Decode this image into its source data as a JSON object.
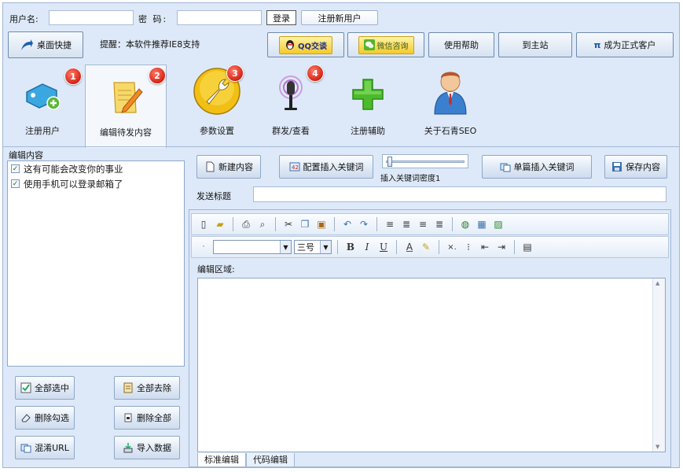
{
  "login": {
    "username_label": "用户名:",
    "password_label": "密  码:",
    "login_button": "登录",
    "register_button": "注册新用户",
    "username_value": "",
    "password_value": ""
  },
  "toolbar": {
    "desktop_shortcut": "桌面快捷",
    "notice": "提醒：本软件推荐IE8支持",
    "qq_button": "QQ交谈",
    "wechat_button": "微信咨询",
    "help_button": "使用帮助",
    "home_button": "到主站",
    "upgrade_button": "成为正式客户",
    "upgrade_prefix": "π"
  },
  "tabs": [
    {
      "label": "注册用户",
      "badge": "1",
      "icon": "tag-add-icon"
    },
    {
      "label": "编辑待发内容",
      "badge": "2",
      "icon": "edit-note-icon"
    },
    {
      "label": "参数设置",
      "badge": "3",
      "icon": "wrench-icon"
    },
    {
      "label": "群发/查看",
      "badge": "4",
      "icon": "microphone-icon"
    },
    {
      "label": "注册辅助",
      "icon": "plus-icon"
    },
    {
      "label": "关于石青SEO",
      "icon": "user-icon"
    }
  ],
  "left": {
    "group_title": "编辑内容",
    "items": [
      "这有可能会改变你的事业",
      "使用手机可以登录邮箱了"
    ],
    "select_all": "全部选中",
    "deselect_all": "全部去除",
    "delete_checked": "删除勾选",
    "delete_all": "删除全部",
    "mix_url": "混淆URL",
    "import_data": "导入数据"
  },
  "content": {
    "new_button": "新建内容",
    "config_keywords_button": "配置插入关键词",
    "keyword_density_label": "插入关键词密度1",
    "keyword_density_value": 0.02,
    "single_insert_button": "单篇插入关键词",
    "save_button": "保存内容",
    "title_label": "发送标题",
    "title_value": "",
    "edit_area_label": "编辑区域:",
    "font_size": "三号",
    "font_name": "",
    "tab_standard": "标准编辑",
    "tab_code": "代码编辑"
  },
  "colors": {
    "window_bg": "#dde9f8",
    "badge_red": "#d42416"
  }
}
